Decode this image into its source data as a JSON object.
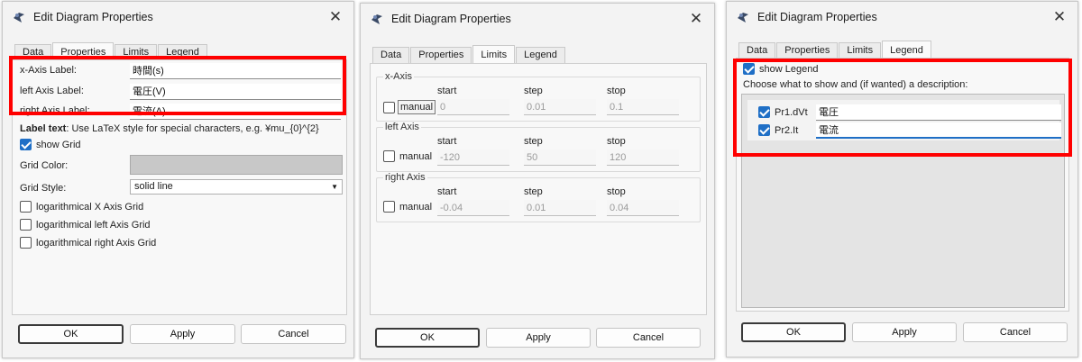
{
  "dialog1": {
    "title": "Edit Diagram Properties",
    "tabs": [
      "Data",
      "Properties",
      "Limits",
      "Legend"
    ],
    "active_tab": "Properties",
    "labels": [
      {
        "label": "x-Axis Label:",
        "value": "時間(s)"
      },
      {
        "label": "left Axis Label:",
        "value": "電圧(V)"
      },
      {
        "label": "right Axis Label:",
        "value": "電流(A)"
      }
    ],
    "label_text_bold": "Label text",
    "label_text_rest": ": Use LaTeX style for special characters, e.g. ¥mu_{0}^{2}",
    "show_grid": "show Grid",
    "grid_color_label": "Grid Color:",
    "grid_style_label": "Grid Style:",
    "grid_style_value": "solid line",
    "log_options": [
      "logarithmical X Axis Grid",
      "logarithmical left Axis Grid",
      "logarithmical right Axis Grid"
    ],
    "buttons": {
      "ok": "OK",
      "apply": "Apply",
      "cancel": "Cancel"
    }
  },
  "dialog2": {
    "title": "Edit Diagram Properties",
    "tabs": [
      "Data",
      "Properties",
      "Limits",
      "Legend"
    ],
    "active_tab": "Limits",
    "col_headers": [
      "start",
      "step",
      "stop"
    ],
    "groups": [
      {
        "name": "x-Axis",
        "manual": "manual",
        "start": "0",
        "step": "0.01",
        "stop": "0.1"
      },
      {
        "name": "left Axis",
        "manual": "manual",
        "start": "-120",
        "step": "50",
        "stop": "120"
      },
      {
        "name": "right Axis",
        "manual": "manual",
        "start": "-0.04",
        "step": "0.01",
        "stop": "0.04"
      }
    ],
    "buttons": {
      "ok": "OK",
      "apply": "Apply",
      "cancel": "Cancel"
    }
  },
  "dialog3": {
    "title": "Edit Diagram Properties",
    "tabs": [
      "Data",
      "Properties",
      "Limits",
      "Legend"
    ],
    "active_tab": "Legend",
    "show_legend": "show Legend",
    "instruction": "Choose what to show and (if wanted) a description:",
    "entries": [
      {
        "name": "Pr1.dVt",
        "desc": "電圧"
      },
      {
        "name": "Pr2.It",
        "desc": "電流"
      }
    ],
    "buttons": {
      "ok": "OK",
      "apply": "Apply",
      "cancel": "Cancel"
    }
  },
  "colors": {
    "highlight": "#ff0000",
    "accent": "#1f6fc6",
    "grid_swatch": "#c8c8c8"
  }
}
